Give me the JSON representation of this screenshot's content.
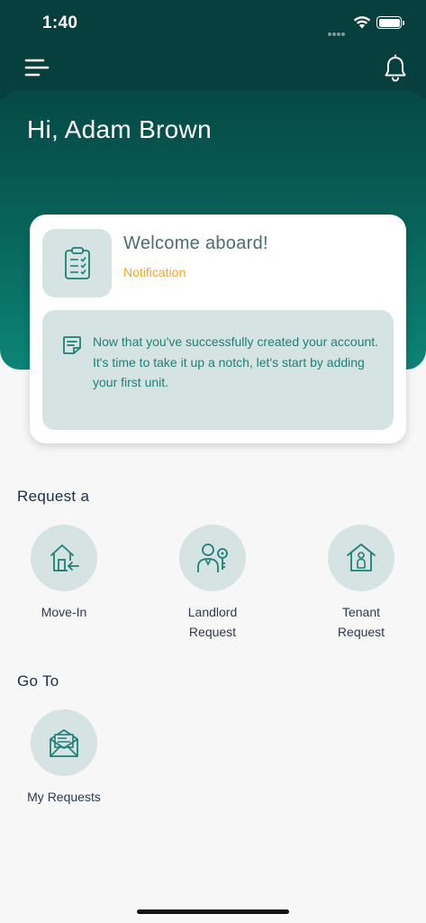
{
  "status_bar": {
    "time": "1:40"
  },
  "header": {
    "menu_icon": "hamburger-menu-icon",
    "notification_icon": "bell-icon",
    "greeting": "Hi, Adam Brown"
  },
  "welcome_card": {
    "icon": "clipboard-checklist-icon",
    "title": "Welcome aboard!",
    "subtitle": "Notification",
    "message_icon": "note-icon",
    "message": "Now that you've successfully created your account. It's time to take it up a notch, let's start by adding your first unit."
  },
  "request_section": {
    "title": "Request a",
    "items": [
      {
        "label_line1": "Move-In",
        "label_line2": "",
        "icon": "house-arrow-icon"
      },
      {
        "label_line1": "Landlord",
        "label_line2": "Request",
        "icon": "person-key-icon"
      },
      {
        "label_line1": "Tenant",
        "label_line2": "Request",
        "icon": "house-person-icon"
      }
    ]
  },
  "goto_section": {
    "title": "Go To",
    "items": [
      {
        "label_line1": "My Requests",
        "icon": "envelope-letter-icon"
      }
    ]
  },
  "colors": {
    "header_dark": "#053b3a",
    "header_light": "#0c8477",
    "accent_orange": "#f0a62a",
    "icon_teal": "#1f7f78",
    "tile_bg": "#d5e3e2"
  }
}
